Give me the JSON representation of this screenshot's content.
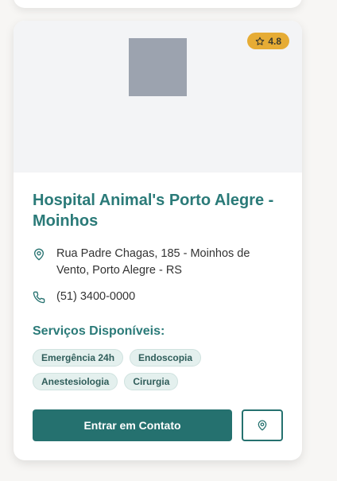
{
  "card": {
    "rating": "4.8",
    "title": "Hospital Animal's Porto Alegre - Moinhos",
    "address": "Rua Padre Chagas, 185 - Moinhos de Vento, Porto Alegre - RS",
    "phone": "(51) 3400-0000",
    "services_title": "Serviços Disponíveis:",
    "services": [
      "Emergência 24h",
      "Endoscopia",
      "Anestesiologia",
      "Cirurgia"
    ],
    "contact_button": "Entrar em Contato",
    "icons": {
      "rating": "star-icon",
      "address": "map-pin-icon",
      "phone": "phone-icon",
      "map_button": "map-pin-icon"
    }
  },
  "colors": {
    "accent": "#25716f",
    "title": "#2a7a78",
    "badge": "#e6ac35",
    "tag_bg": "#e4f0ee"
  }
}
